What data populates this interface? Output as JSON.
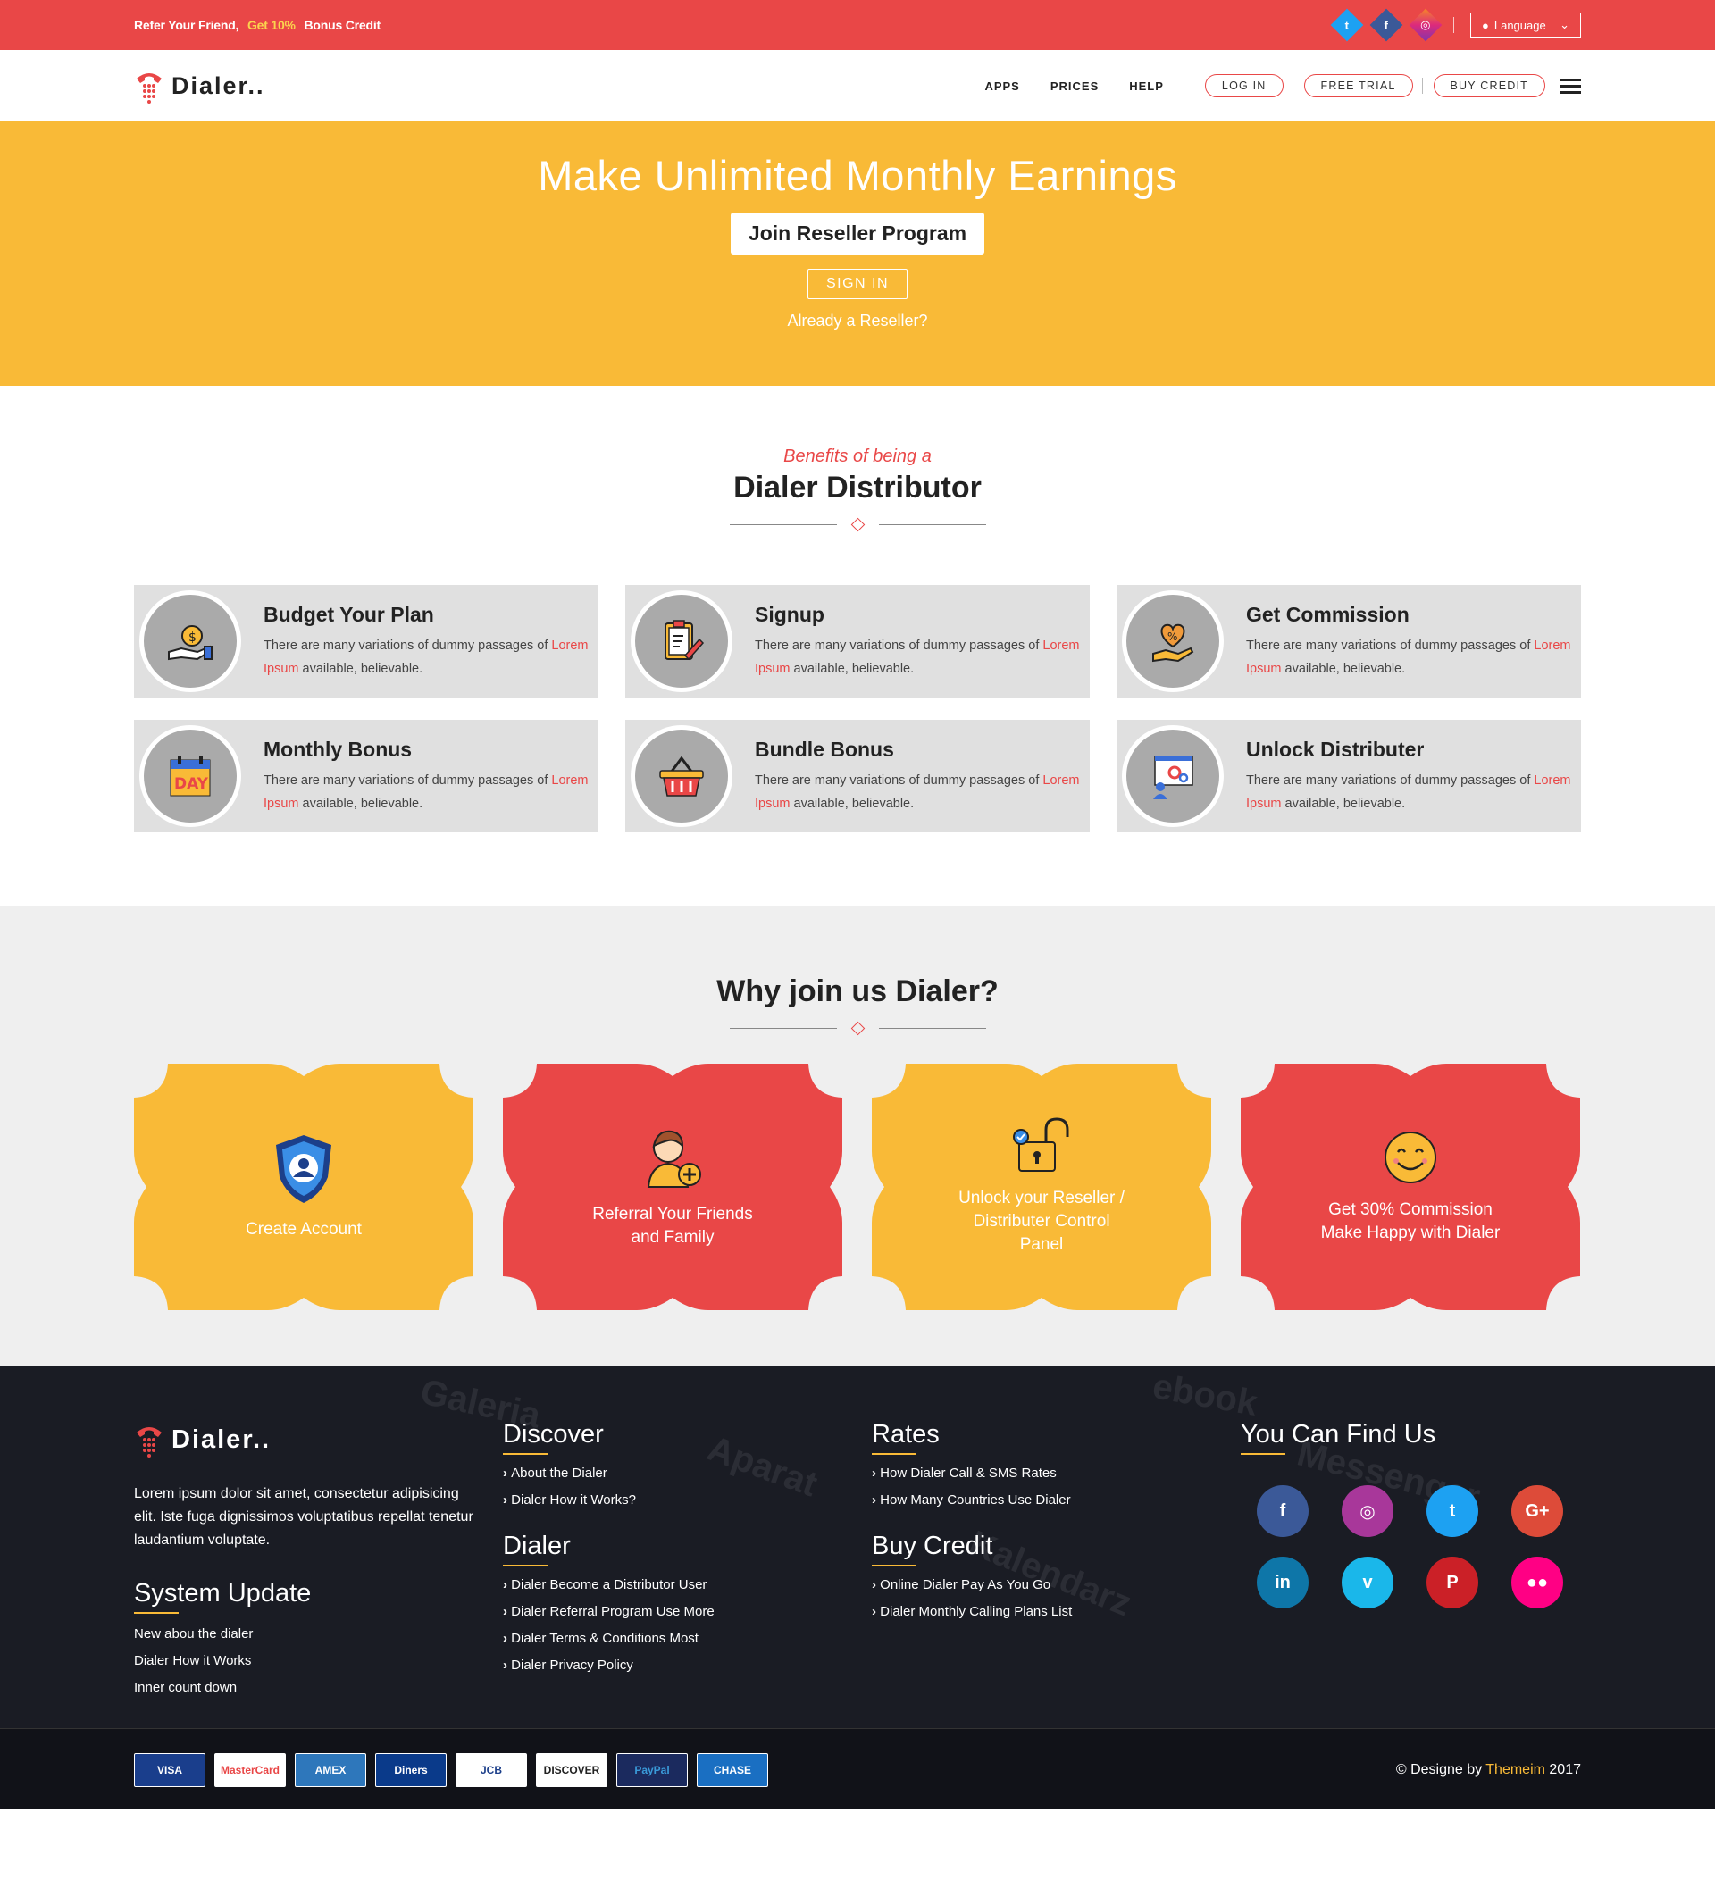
{
  "topbar": {
    "refer_a": "Refer Your Friend,",
    "refer_b": "Get 10%",
    "refer_c": "Bonus Credit",
    "language": "Language"
  },
  "nav": {
    "logo": "Dialer..",
    "items": [
      "APPS",
      "PRICES",
      "HELP"
    ],
    "buttons": [
      "LOG IN",
      "FREE TRIAL",
      "BUY CREDIT"
    ]
  },
  "hero": {
    "title": "Make Unlimited Monthly Earnings",
    "join_button": "Join Reseller Program",
    "signin_button": "SIGN IN",
    "already": "Already a Reseller?"
  },
  "benefits": {
    "subtitle": "Benefits of being a",
    "title": "Dialer Distributor",
    "items": [
      {
        "title": "Budget Your Plan",
        "text_a": "There are many variations of dummy passages of ",
        "link": "Lorem Ipsum",
        "text_b": " available, believable.",
        "icon": "money-hand-icon"
      },
      {
        "title": "Signup",
        "text_a": "There are many variations of dummy passages of ",
        "link": "Lorem Ipsum",
        "text_b": " available, believable.",
        "icon": "clipboard-pen-icon"
      },
      {
        "title": "Get Commission",
        "text_a": "There are many variations of dummy passages of ",
        "link": "Lorem Ipsum",
        "text_b": " available, believable.",
        "icon": "heart-percent-hand-icon"
      },
      {
        "title": "Monthly Bonus",
        "text_a": "There are many variations of dummy passages of ",
        "link": "Lorem Ipsum",
        "text_b": " available, believable.",
        "icon": "calendar-day-icon"
      },
      {
        "title": "Bundle Bonus",
        "text_a": "There are many variations of dummy passages of ",
        "link": "Lorem Ipsum",
        "text_b": " available, believable.",
        "icon": "basket-icon"
      },
      {
        "title": "Unlock Distributer",
        "text_a": "There are many variations of dummy passages of ",
        "link": "Lorem Ipsum",
        "text_b": " available, believable.",
        "icon": "presentation-gear-icon"
      }
    ]
  },
  "why": {
    "title": "Why join us Dialer?",
    "items": [
      {
        "line1": "Create Account",
        "line2": "",
        "line3": "",
        "color": "#f9ba37",
        "icon": "shield-user-icon"
      },
      {
        "line1": "Referral Your Friends",
        "line2": "and Family",
        "line3": "",
        "color": "#e94747",
        "icon": "person-add-icon"
      },
      {
        "line1": "Unlock your Reseller /",
        "line2": "Distributer Control",
        "line3": "Panel",
        "color": "#f9ba37",
        "icon": "padlock-icon"
      },
      {
        "line1": "Get 30% Commission",
        "line2": "Make Happy with Dialer",
        "line3": "",
        "color": "#e94747",
        "icon": "smiley-icon"
      }
    ]
  },
  "footer": {
    "logo": "Dialer..",
    "description": "Lorem ipsum dolor sit amet, consectetur adipisicing elit. Iste fuga dignissimos voluptatibus repellat tenetur laudantium voluptate.",
    "system_update": {
      "title": "System Update",
      "items": [
        "New abou the dialer",
        "Dialer How it Works",
        "Inner count down"
      ]
    },
    "discover": {
      "title": "Discover",
      "items": [
        "About the Dialer",
        "Dialer How it Works?"
      ]
    },
    "dialer": {
      "title": "Dialer",
      "items": [
        "Dialer Become a Distributor User",
        "Dialer Referral Program Use More",
        "Dialer Terms & Conditions Most",
        "Dialer Privacy Policy"
      ]
    },
    "rates": {
      "title": "Rates",
      "items": [
        "How Dialer Call & SMS Rates",
        "How Many Countries Use Dialer"
      ]
    },
    "buy_credit": {
      "title": "Buy Credit",
      "items": [
        "Online Dialer Pay As You Go",
        "Dialer Monthly Calling Plans List"
      ]
    },
    "find_us": {
      "title": "You Can Find Us",
      "socials": [
        {
          "name": "facebook-icon",
          "glyph": "f",
          "color": "#3b5998"
        },
        {
          "name": "instagram-icon",
          "glyph": "◎",
          "color": "#a8379a"
        },
        {
          "name": "twitter-icon",
          "glyph": "t",
          "color": "#1da1f2"
        },
        {
          "name": "google-plus-icon",
          "glyph": "G+",
          "color": "#dd4b39"
        },
        {
          "name": "linkedin-icon",
          "glyph": "in",
          "color": "#0e76a8"
        },
        {
          "name": "vimeo-icon",
          "glyph": "v",
          "color": "#1ab7ea"
        },
        {
          "name": "pinterest-icon",
          "glyph": "P",
          "color": "#cb2027"
        },
        {
          "name": "flickr-icon",
          "glyph": "●●",
          "color": "#ff0084"
        }
      ]
    },
    "payments": [
      "VISA",
      "MasterCard",
      "AMEX",
      "Diners",
      "JCB",
      "DISCOVER",
      "PayPal",
      "CHASE"
    ],
    "copyright_a": "© Designe by",
    "copyright_b": "Themeim",
    "copyright_c": "2017"
  }
}
